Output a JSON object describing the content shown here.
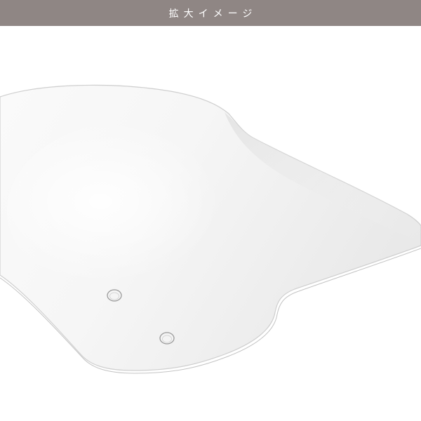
{
  "header": {
    "title": "拡大イメージ",
    "background_color": "#8f8684",
    "text_color": "#ffffff"
  },
  "image": {
    "subject": "clear-acrylic-windscreen-panel",
    "background_color": "#ffffff"
  }
}
